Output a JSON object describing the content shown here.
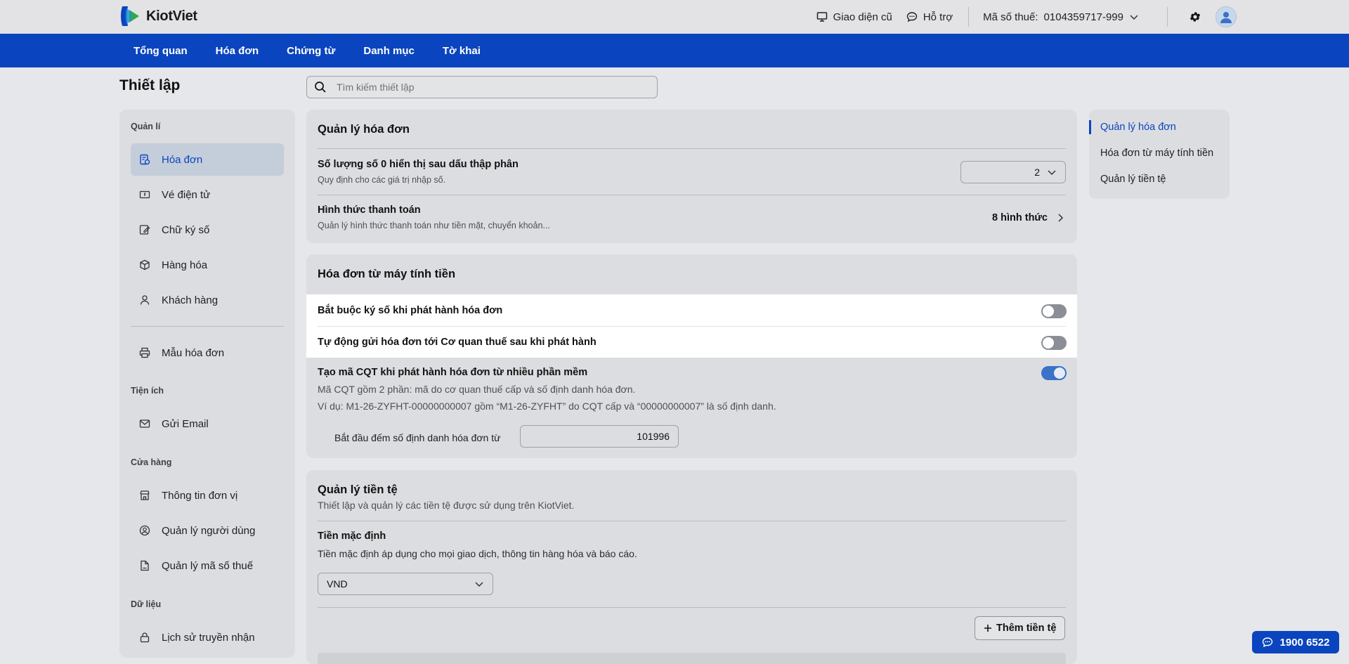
{
  "app": {
    "name": "KiotViet"
  },
  "header": {
    "old_ui": "Giao diện cũ",
    "support": "Hỗ trợ",
    "tax_label": "Mã số thuế:",
    "tax_value": "0104359717-999"
  },
  "nav": {
    "items": [
      "Tổng quan",
      "Hóa đơn",
      "Chứng từ",
      "Danh mục",
      "Tờ khai"
    ]
  },
  "page": {
    "title": "Thiết lập",
    "search_placeholder": "Tìm kiếm thiết lập"
  },
  "sidebar": {
    "group_manage": "Quản lí",
    "invoice": "Hóa đơn",
    "e_ticket": "Vé điện tử",
    "signature": "Chữ ký số",
    "goods": "Hàng hóa",
    "customer": "Khách hàng",
    "invoice_template": "Mẫu hóa đơn",
    "group_utility": "Tiện ích",
    "send_email": "Gửi Email",
    "group_store": "Cửa hàng",
    "unit_info": "Thông tin đơn vị",
    "users": "Quản lý người dùng",
    "tax_codes": "Quản lý mã số thuế",
    "group_data": "Dữ liệu",
    "history": "Lịch sử truyền nhận"
  },
  "invoice_mgmt": {
    "title": "Quản lý hóa đơn",
    "decimal_title": "Số lượng số 0 hiển thị sau dấu thập phân",
    "decimal_sub": "Quy định cho các giá trị nhập số.",
    "decimal_value": "2",
    "payment_title": "Hình thức thanh toán",
    "payment_sub": "Quản lý hình thức thanh toán như tiền mặt, chuyển khoản...",
    "payment_count": "8 hình thức"
  },
  "cash_register": {
    "title": "Hóa đơn từ máy tính tiền",
    "require_sign": "Bắt buộc ký số khi phát hành hóa đơn",
    "require_sign_on": false,
    "auto_send": "Tự động gửi hóa đơn tới Cơ quan thuế sau khi phát hành",
    "auto_send_on": false,
    "cqt_title": "Tạo mã CQT khi phát hành hóa đơn từ nhiều phần mềm",
    "cqt_on": true,
    "cqt_desc1": "Mã CQT gồm 2 phần: mã do cơ quan thuế cấp và số định danh hóa đơn.",
    "cqt_desc2": "Ví dụ: M1-26-ZYFHT-00000000007 gồm “M1-26-ZYFHT” do CQT cấp và “00000000007” là số định danh.",
    "start_label": "Bắt đầu đếm số định danh hóa đơn từ",
    "start_value": "101996"
  },
  "currency": {
    "title": "Quản lý tiền tệ",
    "sub": "Thiết lập và quản lý các tiền tệ được sử dụng trên KiotViet.",
    "default_title": "Tiền mặc định",
    "default_sub": "Tiền mặc định áp dụng cho mọi giao dịch, thông tin hàng hóa và báo cáo.",
    "default_value": "VND",
    "add_button": "Thêm tiền tệ"
  },
  "toc": {
    "items": [
      "Quản lý hóa đơn",
      "Hóa đơn từ máy tính tiền",
      "Quản lý tiền tệ"
    ]
  },
  "hotline": "1900 6522",
  "colors": {
    "brand": "#0a45bf",
    "toggle_on": "#3a72c8",
    "toggle_off": "#8a8f97"
  }
}
